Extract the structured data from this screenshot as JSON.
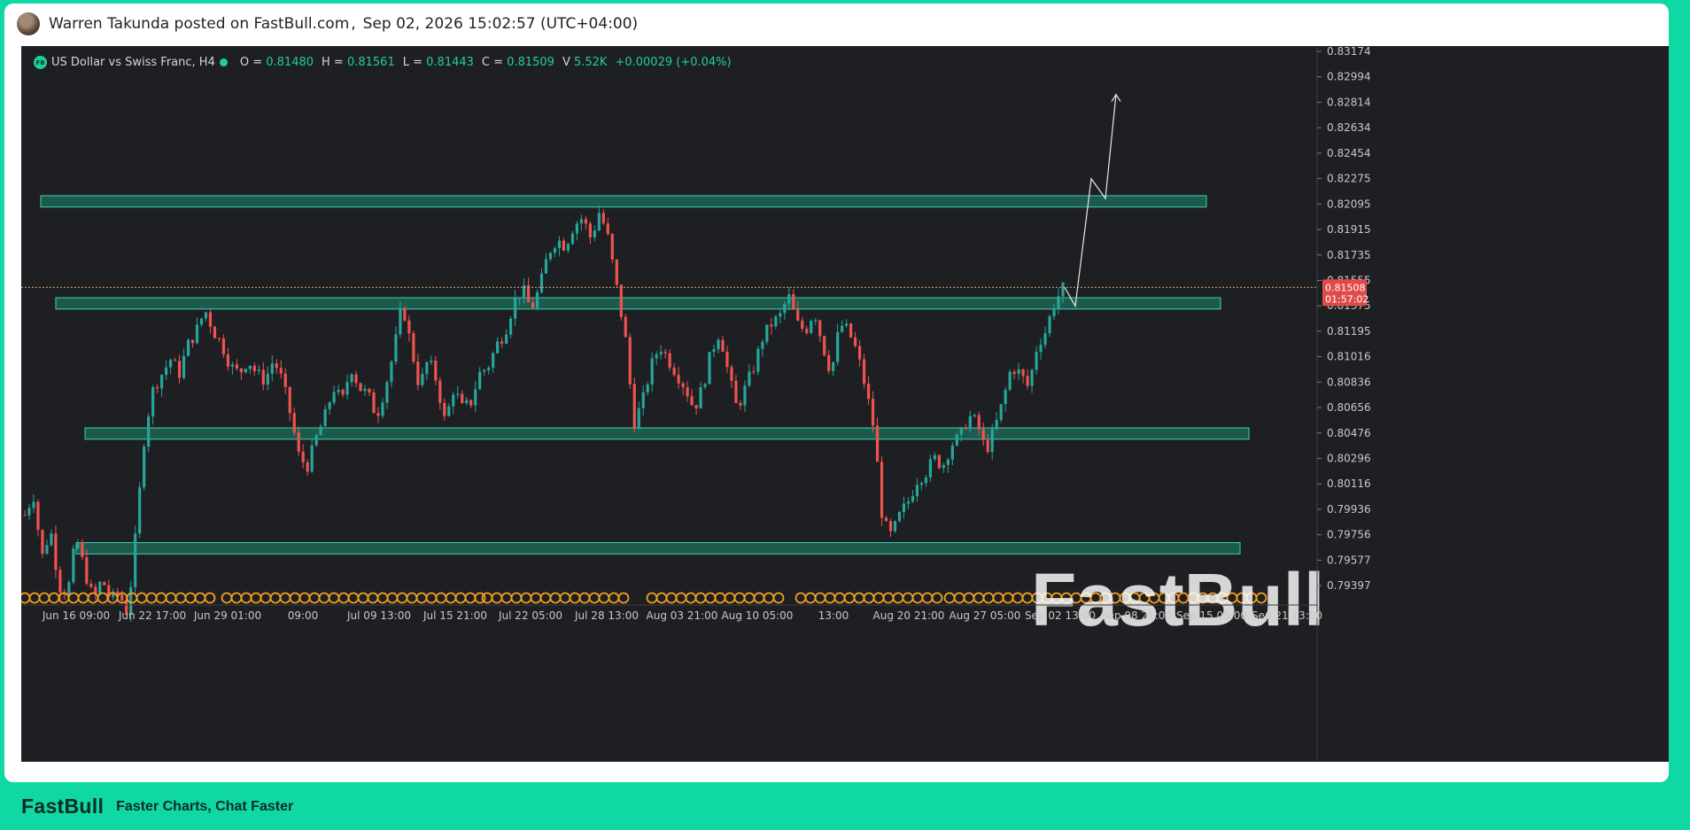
{
  "header": {
    "author_line": "Warren Takunda posted on FastBull.com",
    "separator": ",",
    "timestamp": "Sep 02, 2026 15:02:57 (UTC+04:00)"
  },
  "legend": {
    "badge": "FB",
    "symbol": "US Dollar vs Swiss Franc, H4",
    "open_label": "O =",
    "open": "0.81480",
    "high_label": "H =",
    "high": "0.81561",
    "low_label": "L =",
    "low": "0.81443",
    "close_label": "C =",
    "close": "0.81509",
    "volume_label": "V",
    "volume": "5.52K",
    "change": "+0.00029 (+0.04%)"
  },
  "footer": {
    "brand": "FastBull",
    "tagline": "Faster Charts, Chat Faster"
  },
  "colors": {
    "up": "#26a69a",
    "down": "#ef5350",
    "zone_fill": "#1d8a73",
    "zone_stroke": "#3fd1ad",
    "price_tag": "#e04a4a",
    "event_marker": "#f0a020",
    "background": "#1e1f23"
  },
  "chart_data": {
    "type": "candlestick",
    "title": "US Dollar vs Swiss Franc, H4",
    "y_tick_labels": [
      "0.83174",
      "0.82994",
      "0.82814",
      "0.82634",
      "0.82454",
      "0.82275",
      "0.82095",
      "0.81915",
      "0.81735",
      "0.81555",
      "0.81375",
      "0.81195",
      "0.81016",
      "0.80836",
      "0.80656",
      "0.80476",
      "0.80296",
      "0.80116",
      "0.79936",
      "0.79756",
      "0.79577",
      "0.79397"
    ],
    "ylim": [
      0.793,
      0.8322
    ],
    "x_tick_labels": [
      "Jun 16 09:00",
      "Jun 22 17:00",
      "Jun 29 01:00",
      "09:00",
      "Jul 09 13:00",
      "Jul 15 21:00",
      "Jul 22 05:00",
      "Jul 28 13:00",
      "Aug 03 21:00",
      "Aug 10 05:00",
      "13:00",
      "Aug 20 21:00",
      "Aug 27 05:00",
      "Sep 02 13:00",
      "Sep 08 21:00",
      "Sep 15 05:00",
      "Sep 21 13:00"
    ],
    "last_price": "0.81508",
    "last_price_value": 0.81508,
    "countdown": "01:57:02",
    "price_path": [
      [
        0.799,
        0.8005,
        0.796,
        0.798,
        0.794,
        0.7935,
        0.7975,
        0.795,
        0.793,
        0.7945,
        0.793,
        0.7935,
        0.792,
        0.798,
        0.805,
        0.808,
        0.809,
        0.81,
        0.809,
        0.811,
        0.812,
        0.8135,
        0.812,
        0.811,
        0.8095,
        0.809,
        0.81,
        0.809,
        0.8085,
        0.81,
        0.8085,
        0.806,
        0.803,
        0.8025,
        0.8045,
        0.806,
        0.808,
        0.807,
        0.8095,
        0.808,
        0.8075,
        0.806,
        0.808,
        0.8105,
        0.814,
        0.811,
        0.808,
        0.81,
        0.8085,
        0.8055,
        0.808,
        0.8065,
        0.807,
        0.809,
        0.8095,
        0.811,
        0.812,
        0.814,
        0.815,
        0.8135,
        0.815,
        0.8175,
        0.8185,
        0.818,
        0.8195,
        0.82,
        0.8185,
        0.8205,
        0.8185,
        0.815,
        0.8115,
        0.8055,
        0.807,
        0.8095,
        0.811,
        0.81,
        0.809,
        0.808,
        0.8065,
        0.808,
        0.8105,
        0.812,
        0.809,
        0.8065,
        0.808,
        0.8095,
        0.8115,
        0.8125,
        0.813,
        0.8145,
        0.8125,
        0.812,
        0.8135,
        0.811,
        0.809,
        0.8125,
        0.812,
        0.8105,
        0.808,
        0.805,
        0.7985,
        0.7975,
        0.799,
        0.8,
        0.8015,
        0.802,
        0.803,
        0.8025,
        0.804,
        0.8045,
        0.806,
        0.8055,
        0.8035,
        0.805,
        0.807,
        0.8095,
        0.809,
        0.808,
        0.811,
        0.812,
        0.814,
        0.815
      ]
    ],
    "zones": [
      {
        "low": 0.82075,
        "high": 0.82155
      },
      {
        "low": 0.81355,
        "high": 0.81435
      },
      {
        "low": 0.80436,
        "high": 0.80516
      },
      {
        "low": 0.79626,
        "high": 0.79706
      }
    ],
    "projection": [
      0.81508,
      0.81376,
      0.82275,
      0.82135,
      0.8287
    ],
    "watermark": "FastBull",
    "grid": false
  }
}
